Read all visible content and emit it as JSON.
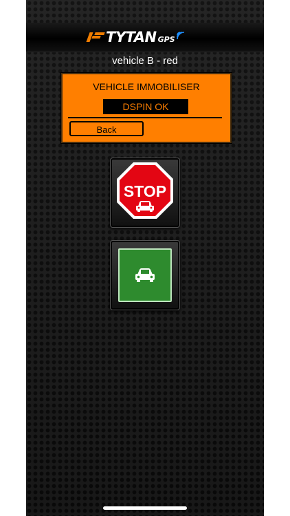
{
  "brand": {
    "logo_text": "TYTAN",
    "logo_suffix": "GPS",
    "accent_color": "#f07d00"
  },
  "vehicle": {
    "title": "vehicle B - red"
  },
  "immobiliser_panel": {
    "title": "VEHICLE IMMOBILISER",
    "status": "DSPIN OK",
    "back_label": "Back",
    "background_color": "#ff7f00"
  },
  "controls": {
    "stop_label": "STOP",
    "stop_icon": "stop-sign-with-car-icon",
    "go_icon": "car-icon",
    "stop_color": "#e30613",
    "go_color": "#2e8b2e"
  }
}
